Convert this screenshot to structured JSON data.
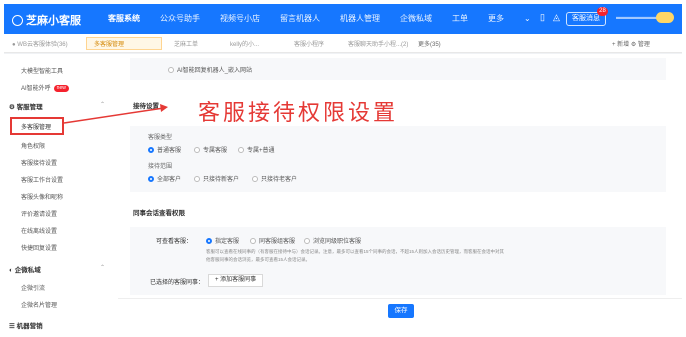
{
  "topbar": {
    "app_name": "芝麻小客服",
    "nav": [
      "客服系统",
      "公众号助手",
      "视频号小店",
      "留言机器人",
      "机器人管理",
      "企微私域",
      "工单",
      "更多"
    ],
    "message_label": "客服消息",
    "message_badge": "28"
  },
  "tabs": {
    "items": [
      "●  WB云客服体验(36)",
      "多客服管理",
      "芝麻工单",
      "kelly的小...",
      "客服小程序",
      "客服聊天助手小程...(2)"
    ],
    "more_label": "更多(35)",
    "add_label": "+ 新增",
    "manage_label": "⚙ 管理"
  },
  "sidebar": {
    "items": [
      {
        "label": "大模型智能工具",
        "kind": "item"
      },
      {
        "label": "AI智能外呼",
        "kind": "item",
        "badge": "new"
      },
      {
        "label": "客服管理",
        "kind": "head"
      },
      {
        "label": "多客服管理",
        "kind": "item",
        "selected": true
      },
      {
        "label": "角色权限",
        "kind": "item"
      },
      {
        "label": "客服接待设置",
        "kind": "item"
      },
      {
        "label": "客服工作台设置",
        "kind": "item"
      },
      {
        "label": "客服头像和昵称",
        "kind": "item"
      },
      {
        "label": "评价邀请设置",
        "kind": "item"
      },
      {
        "label": "在线离线设置",
        "kind": "item"
      },
      {
        "label": "快捷回复设置",
        "kind": "item"
      },
      {
        "label": "企微私域",
        "kind": "head"
      },
      {
        "label": "企微引流",
        "kind": "item"
      },
      {
        "label": "企微名片管理",
        "kind": "item"
      },
      {
        "label": "机器营销",
        "kind": "head"
      }
    ]
  },
  "content": {
    "top_option": "AI智能回复机器人_嵌入网站",
    "reception_title": "接待设置",
    "type_label": "客服类型",
    "type_options": [
      "普通客服",
      "专属客服",
      "专属+普通"
    ],
    "scope_label": "接待范围",
    "scope_options": [
      "全部客户",
      "只接待新客户",
      "只接待老客户"
    ],
    "colleague_title": "同事会话查看权限",
    "view_label": "可查看客服：",
    "view_options": [
      "指定客服",
      "同客服组客服",
      "浏览同级职位客服"
    ],
    "note": "客服可以查看在线同事的（有客服在接待中与）会话记录。注意，最多可以查看15个同事的会话，不超15人则加入会话历史管理，而客服在会话中对其他客服同事的会话浏览，最多可查看15人会话记录。",
    "selected_label": "已选择的客服同事：",
    "add_button": "+ 添加客服同事",
    "save_button": "保存"
  },
  "annotation": {
    "title": "客服接待权限设置",
    "color": "#e53935"
  }
}
